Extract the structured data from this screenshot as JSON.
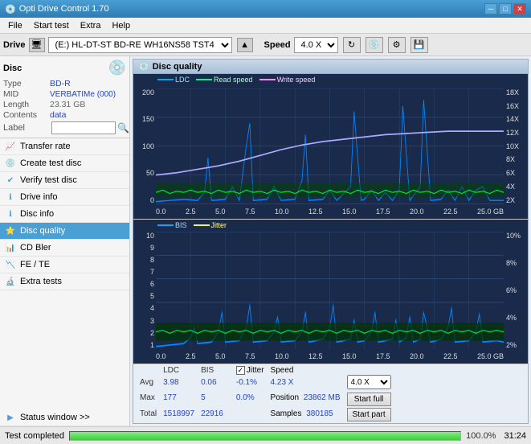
{
  "app": {
    "title": "Opti Drive Control 1.70",
    "titlebar_buttons": [
      "minimize",
      "maximize",
      "close"
    ]
  },
  "menu": {
    "items": [
      "File",
      "Start test",
      "Extra",
      "Help"
    ]
  },
  "drive_bar": {
    "label": "Drive",
    "drive_value": "(E:)  HL-DT-ST BD-RE  WH16NS58 TST4",
    "speed_label": "Speed",
    "speed_value": "4.0 X"
  },
  "disc": {
    "title": "Disc",
    "type_label": "Type",
    "type_value": "BD-R",
    "mid_label": "MID",
    "mid_value": "VERBATIMe (000)",
    "length_label": "Length",
    "length_value": "23.31 GB",
    "contents_label": "Contents",
    "contents_value": "data",
    "label_label": "Label",
    "label_value": ""
  },
  "nav": {
    "items": [
      {
        "id": "transfer-rate",
        "label": "Transfer rate",
        "active": false
      },
      {
        "id": "create-test-disc",
        "label": "Create test disc",
        "active": false
      },
      {
        "id": "verify-test-disc",
        "label": "Verify test disc",
        "active": false
      },
      {
        "id": "drive-info",
        "label": "Drive info",
        "active": false
      },
      {
        "id": "disc-info",
        "label": "Disc info",
        "active": false
      },
      {
        "id": "disc-quality",
        "label": "Disc quality",
        "active": true
      },
      {
        "id": "cd-bler",
        "label": "CD Bler",
        "active": false
      },
      {
        "id": "fe-te",
        "label": "FE / TE",
        "active": false
      },
      {
        "id": "extra-tests",
        "label": "Extra tests",
        "active": false
      }
    ],
    "status_window": "Status window >>"
  },
  "chart": {
    "title": "Disc quality",
    "legend_upper": [
      {
        "label": "LDC",
        "color": "#00aaff"
      },
      {
        "label": "Read speed",
        "color": "#00ff00"
      },
      {
        "label": "Write speed",
        "color": "#ff88ff"
      }
    ],
    "legend_lower": [
      {
        "label": "BIS",
        "color": "#00aaff"
      },
      {
        "label": "Jitter",
        "color": "#ffff00"
      }
    ],
    "upper_y_left": [
      "200",
      "150",
      "100",
      "50",
      "0"
    ],
    "upper_y_right": [
      "18X",
      "16X",
      "14X",
      "12X",
      "10X",
      "8X",
      "6X",
      "4X",
      "2X"
    ],
    "lower_y_left": [
      "10",
      "9",
      "8",
      "7",
      "6",
      "5",
      "4",
      "3",
      "2",
      "1"
    ],
    "lower_y_right": [
      "10%",
      "8%",
      "6%",
      "4%",
      "2%"
    ],
    "x_axis": [
      "0.0",
      "2.5",
      "5.0",
      "7.5",
      "10.0",
      "12.5",
      "15.0",
      "17.5",
      "20.0",
      "22.5",
      "25.0 GB"
    ]
  },
  "stats": {
    "columns": [
      "",
      "LDC",
      "BIS",
      "",
      "Jitter",
      "Speed",
      ""
    ],
    "avg_label": "Avg",
    "avg_ldc": "3.98",
    "avg_bis": "0.06",
    "avg_jitter": "-0.1%",
    "max_label": "Max",
    "max_ldc": "177",
    "max_bis": "5",
    "max_jitter": "0.0%",
    "total_label": "Total",
    "total_ldc": "1518997",
    "total_bis": "22916",
    "speed_label": "Speed",
    "speed_value": "4.23 X",
    "speed_select": "4.0 X",
    "position_label": "Position",
    "position_value": "23862 MB",
    "samples_label": "Samples",
    "samples_value": "380185",
    "jitter_checked": true,
    "start_full": "Start full",
    "start_part": "Start part"
  },
  "status": {
    "text": "Test completed",
    "progress": 100,
    "time": "31:24"
  }
}
